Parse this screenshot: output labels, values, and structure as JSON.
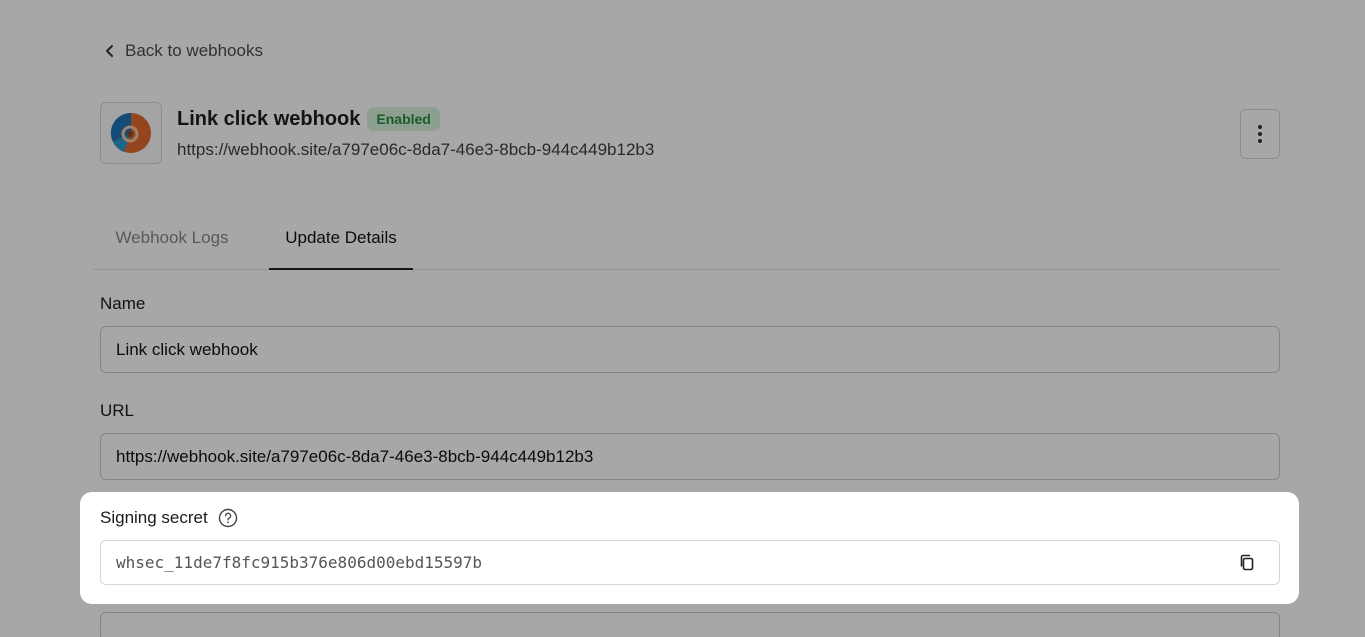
{
  "nav": {
    "back_label": "Back to webhooks"
  },
  "webhook": {
    "title": "Link click webhook",
    "status": "Enabled",
    "url": "https://webhook.site/a797e06c-8da7-46e3-8bcb-944c449b12b3"
  },
  "tabs": [
    {
      "label": "Webhook Logs",
      "active": false
    },
    {
      "label": "Update Details",
      "active": true
    }
  ],
  "form": {
    "name": {
      "label": "Name",
      "value": "Link click webhook"
    },
    "url": {
      "label": "URL",
      "value": "https://webhook.site/a797e06c-8da7-46e3-8bcb-944c449b12b3"
    },
    "signing_secret": {
      "label": "Signing secret",
      "value": "whsec_11de7f8fc915b376e806d00ebd15597b"
    }
  },
  "icons": {
    "back": "chevron-left-icon",
    "menu": "more-vertical-icon",
    "help": "help-circle-icon",
    "copy": "copy-icon"
  },
  "colors": {
    "badge_bg": "#d7f3dc",
    "badge_text": "#2c8a44",
    "overlay": "rgba(0,0,0,0.345)"
  }
}
